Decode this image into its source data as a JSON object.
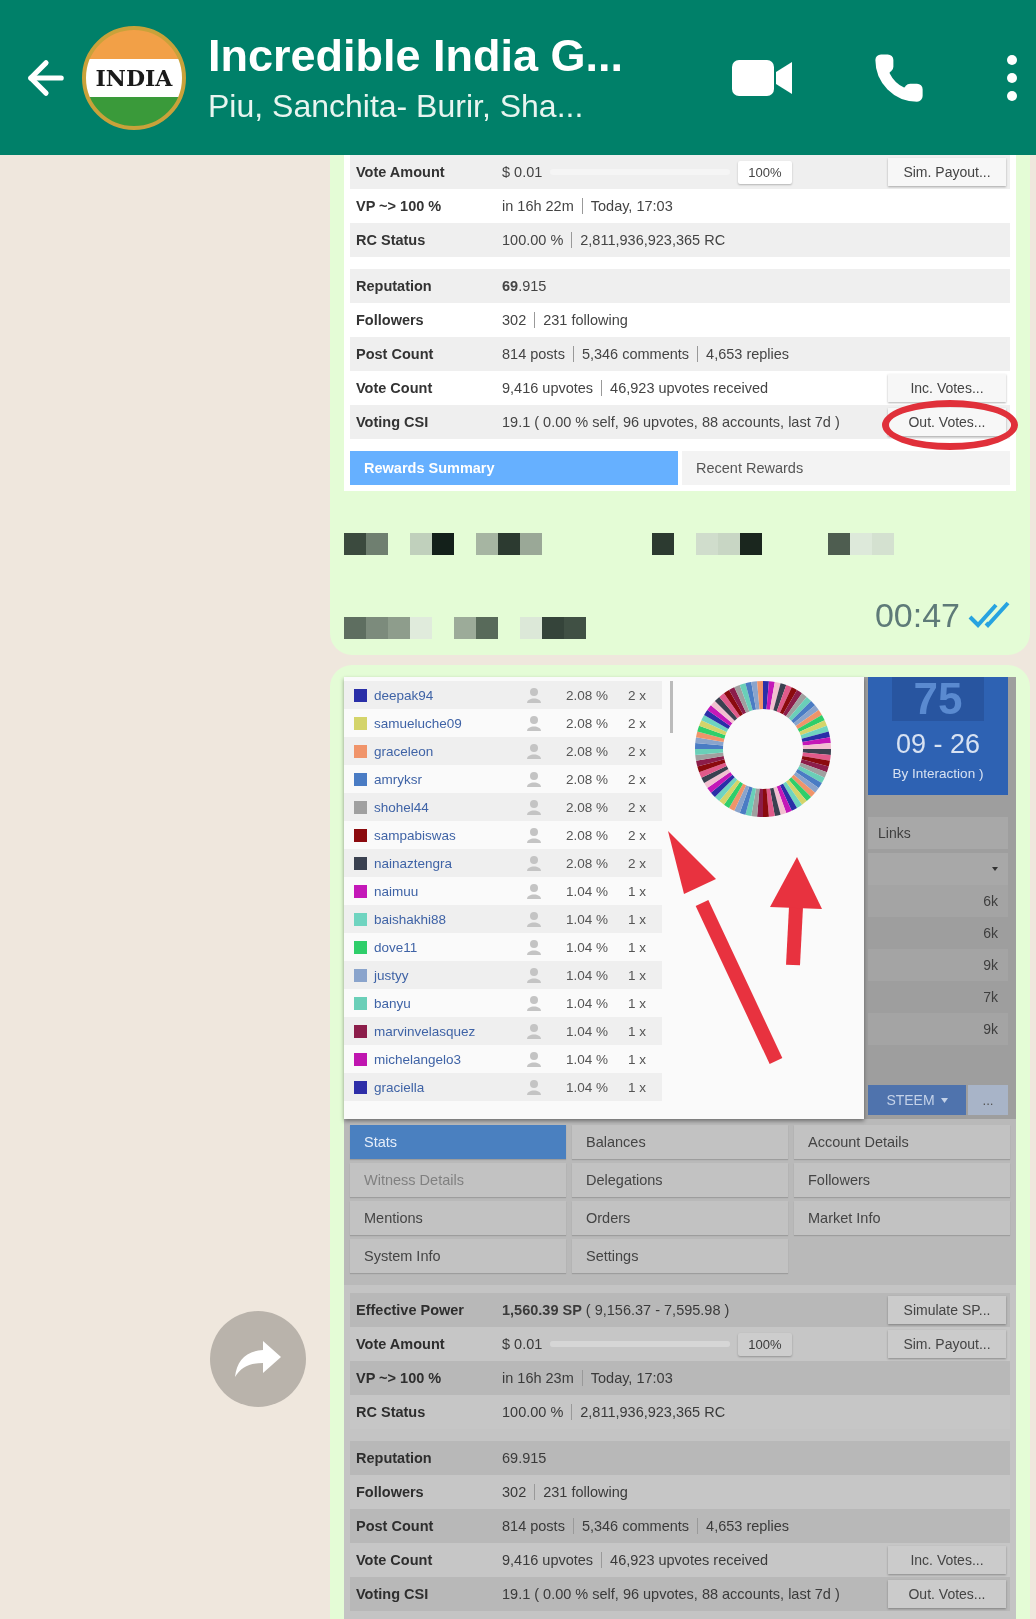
{
  "header": {
    "avatar_label": "INDIA",
    "title": "Incredible India G...",
    "subtitle": "Piu, Sanchita- Burir, Sha..."
  },
  "message_1": {
    "stats_groups": [
      [
        {
          "label": "Vote Amount",
          "parts": [
            "$ 0.01"
          ],
          "slider": {
            "level": 1,
            "reading": "100%"
          },
          "button": "Sim. Payout..."
        },
        {
          "label": "VP ~> 100 %",
          "parts": [
            "in 16h 22m",
            "Today, 17:03"
          ]
        },
        {
          "label": "RC Status",
          "parts": [
            "100.00 %",
            "2,811,936,923,365 RC"
          ]
        }
      ],
      [
        {
          "label": "Reputation",
          "parts": [
            "**69**.915"
          ]
        },
        {
          "label": "Followers",
          "parts": [
            "302",
            "231 following"
          ]
        },
        {
          "label": "Post Count",
          "parts": [
            "814 posts",
            "5,346 comments",
            "4,653 replies"
          ]
        },
        {
          "label": "Vote Count",
          "parts": [
            "9,416 upvotes",
            "46,923 upvotes received"
          ],
          "button": "Inc. Votes..."
        },
        {
          "label": "Voting CSI",
          "parts": [
            "19.1 ( 0.00 % self, 96 upvotes, 88 accounts, last 7d )"
          ],
          "button": "Out. Votes...",
          "circled": true
        }
      ]
    ],
    "tabs": [
      {
        "label": "Rewards Summary",
        "selected": true
      },
      {
        "label": "Recent Rewards",
        "selected": false
      }
    ],
    "time": "00:47",
    "read": true
  },
  "message_2": {
    "vote_list": [
      {
        "name": "deepak94",
        "color": "#2a2fa8",
        "percent": "2.08 %",
        "count": "2 x"
      },
      {
        "name": "samueluche09",
        "color": "#d4d46a",
        "percent": "2.08 %",
        "count": "2 x"
      },
      {
        "name": "graceleon",
        "color": "#f0946a",
        "percent": "2.08 %",
        "count": "2 x"
      },
      {
        "name": "amryksr",
        "color": "#4a7cc4",
        "percent": "2.08 %",
        "count": "2 x"
      },
      {
        "name": "shohel44",
        "color": "#a0a0a0",
        "percent": "2.08 %",
        "count": "2 x"
      },
      {
        "name": "sampabiswas",
        "color": "#8b0a0e",
        "percent": "2.08 %",
        "count": "2 x"
      },
      {
        "name": "nainaztengra",
        "color": "#3a4150",
        "percent": "2.08 %",
        "count": "2 x"
      },
      {
        "name": "naimuu",
        "color": "#c418b8",
        "percent": "1.04 %",
        "count": "1 x"
      },
      {
        "name": "baishakhi88",
        "color": "#6fd4c0",
        "percent": "1.04 %",
        "count": "1 x"
      },
      {
        "name": "dove11",
        "color": "#2fce6a",
        "percent": "1.04 %",
        "count": "1 x"
      },
      {
        "name": "justyy",
        "color": "#8aa4cc",
        "percent": "1.04 %",
        "count": "1 x"
      },
      {
        "name": "banyu",
        "color": "#6acfb8",
        "percent": "1.04 %",
        "count": "1 x"
      },
      {
        "name": "marvinvelasquez",
        "color": "#8c1d4a",
        "percent": "1.04 %",
        "count": "1 x"
      },
      {
        "name": "michelangelo3",
        "color": "#c016b0",
        "percent": "1.04 %",
        "count": "1 x"
      },
      {
        "name": "graciella",
        "color": "#2e2ea8",
        "percent": "1.04 %",
        "count": "1 x"
      }
    ],
    "side_panel": {
      "number": "75",
      "range": "09 - 26",
      "caption": "By Interaction )",
      "links": "Links",
      "values": [
        "6k",
        "6k",
        "9k",
        "7k",
        "9k"
      ],
      "currency": "STEEM",
      "more": "..."
    },
    "nav_tabs": [
      {
        "label": "Stats",
        "selected": true,
        "disabled": false
      },
      {
        "label": "Balances",
        "selected": false,
        "disabled": false
      },
      {
        "label": "Account Details",
        "selected": false,
        "disabled": false
      },
      {
        "label": "Witness Details",
        "selected": false,
        "disabled": true
      },
      {
        "label": "Delegations",
        "selected": false,
        "disabled": false
      },
      {
        "label": "Followers",
        "selected": false,
        "disabled": false
      },
      {
        "label": "Mentions",
        "selected": false,
        "disabled": false
      },
      {
        "label": "Orders",
        "selected": false,
        "disabled": false
      },
      {
        "label": "Market Info",
        "selected": false,
        "disabled": false
      },
      {
        "label": "System Info",
        "selected": false,
        "disabled": false
      },
      {
        "label": "Settings",
        "selected": false,
        "disabled": false
      }
    ],
    "stats_groups": [
      [
        {
          "label": "Effective Power",
          "parts": [
            "**1,560.39 SP** ( 9,156.37 - 7,595.98 )"
          ],
          "button": "Simulate SP..."
        },
        {
          "label": "Vote Amount",
          "parts": [
            "$ 0.01"
          ],
          "slider": {
            "level": 1,
            "reading": "100%"
          },
          "button": "Sim. Payout..."
        },
        {
          "label": "VP ~> 100 %",
          "parts": [
            "in 16h 23m",
            "Today, 17:03"
          ]
        },
        {
          "label": "RC Status",
          "parts": [
            "100.00 %",
            "2,811,936,923,365 RC"
          ]
        }
      ],
      [
        {
          "label": "Reputation",
          "parts": [
            "69.915"
          ]
        },
        {
          "label": "Followers",
          "parts": [
            "302",
            "231 following"
          ]
        },
        {
          "label": "Post Count",
          "parts": [
            "814 posts",
            "5,346 comments",
            "4,653 replies"
          ]
        },
        {
          "label": "Vote Count",
          "parts": [
            "9,416 upvotes",
            "46,923 upvotes received"
          ],
          "button": "Inc. Votes..."
        },
        {
          "label": "Voting CSI",
          "parts": [
            "19.1 ( 0.00 % self, 96 upvotes, 88 accounts, last 7d )"
          ],
          "button": "Out. Votes..."
        }
      ]
    ]
  }
}
